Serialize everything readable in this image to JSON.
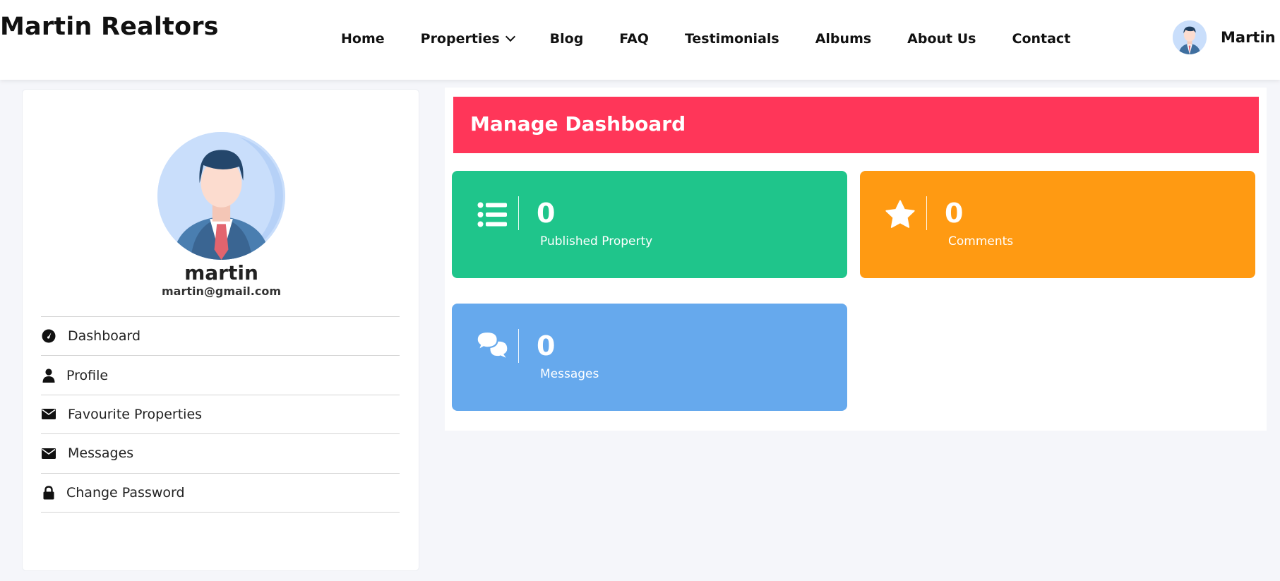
{
  "brand": {
    "title": "Martin Realtors"
  },
  "nav": {
    "items": [
      {
        "label": "Home"
      },
      {
        "label": "Properties",
        "has_dropdown": true
      },
      {
        "label": "Blog"
      },
      {
        "label": "FAQ"
      },
      {
        "label": "Testimonials"
      },
      {
        "label": "Albums"
      },
      {
        "label": "About Us"
      },
      {
        "label": "Contact"
      }
    ]
  },
  "user": {
    "name": "Martin",
    "avatar_icon": "businessman-avatar-icon"
  },
  "sidebar": {
    "profile": {
      "name": "martin",
      "email": "martin@gmail.com"
    },
    "menu": [
      {
        "label": "Dashboard",
        "icon": "dashboard-gauge-icon"
      },
      {
        "label": "Profile",
        "icon": "user-icon"
      },
      {
        "label": "Favourite Properties",
        "icon": "envelope-icon"
      },
      {
        "label": "Messages",
        "icon": "envelope-icon"
      },
      {
        "label": "Change Password",
        "icon": "lock-icon"
      }
    ]
  },
  "main": {
    "banner": {
      "title": "Manage Dashboard",
      "color": "#ff3659"
    },
    "cards": [
      {
        "count": "0",
        "label": "Published Property",
        "icon": "list-icon",
        "color": "#1fc58b"
      },
      {
        "count": "0",
        "label": "Comments",
        "icon": "star-icon",
        "color": "#ff9a12"
      },
      {
        "count": "0",
        "label": "Messages",
        "icon": "chat-bubbles-icon",
        "color": "#66a9ed"
      }
    ]
  }
}
